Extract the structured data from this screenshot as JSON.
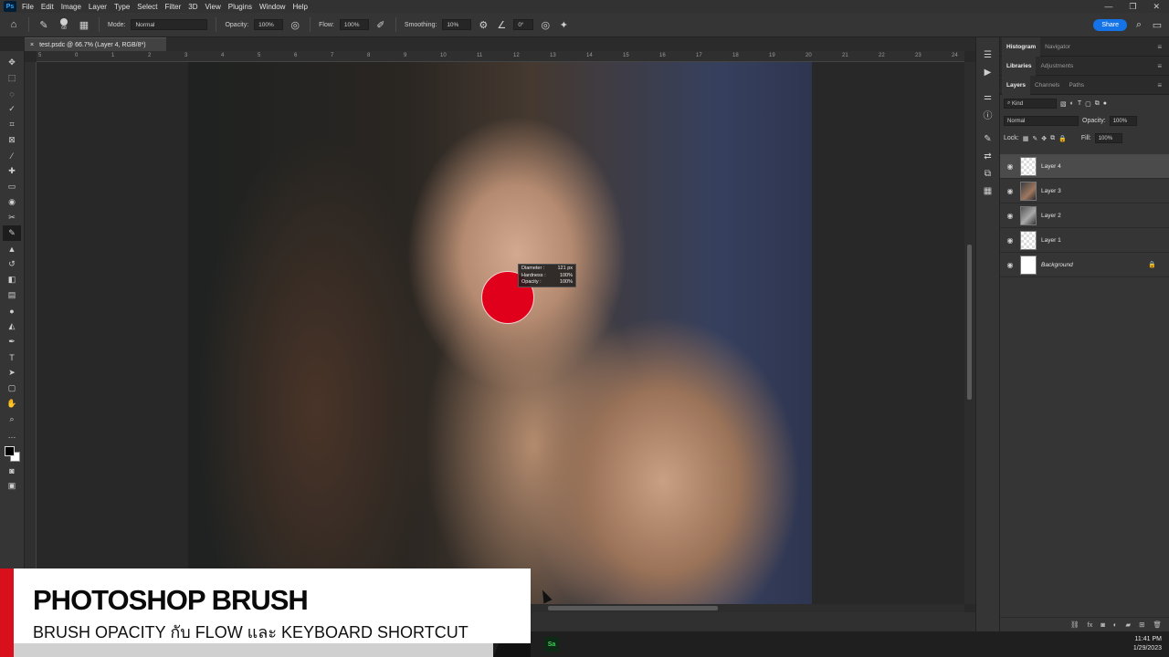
{
  "menubar": {
    "logo": "Ps",
    "items": [
      "File",
      "Edit",
      "Image",
      "Layer",
      "Type",
      "Select",
      "Filter",
      "3D",
      "View",
      "Plugins",
      "Window",
      "Help"
    ],
    "window_controls": [
      "—",
      "❐",
      "✕"
    ]
  },
  "options": {
    "brush_size": "68",
    "mode_label": "Mode:",
    "mode_value": "Normal",
    "opacity_label": "Opacity:",
    "opacity_value": "100%",
    "flow_label": "Flow:",
    "flow_value": "100%",
    "smoothing_label": "Smoothing:",
    "smoothing_value": "10%",
    "angle_value": "0°",
    "share_label": "Share"
  },
  "document": {
    "tab_title": "test.psdc @ 66.7% (Layer 4, RGB/8*)",
    "close": "×"
  },
  "ruler_ticks": [
    "5",
    "0",
    "1",
    "2",
    "3",
    "4",
    "5",
    "6",
    "7",
    "8",
    "9",
    "10",
    "11",
    "12",
    "13",
    "14",
    "15",
    "16",
    "17",
    "18",
    "19",
    "20",
    "21",
    "22",
    "23",
    "24"
  ],
  "brush_tip": {
    "diameter_label": "Diameter :",
    "diameter_value": "121 px",
    "hardness_label": "Hardness :",
    "hardness_value": "100%",
    "opacity_label": "Opacity :",
    "opacity_value": "100%",
    "color": "#e0001b"
  },
  "panels": {
    "group1": [
      "Histogram",
      "Navigator"
    ],
    "group2": [
      "Libraries",
      "Adjustments"
    ],
    "group3": [
      "Layers",
      "Channels",
      "Paths"
    ],
    "kind_label": "Kind",
    "blend_mode": "Normal",
    "opacity_label": "Opacity:",
    "opacity_value": "100%",
    "lock_label": "Lock:",
    "fill_label": "Fill:",
    "fill_value": "100%",
    "layers": [
      {
        "name": "Layer 4",
        "selected": true
      },
      {
        "name": "Layer 3",
        "selected": false
      },
      {
        "name": "Layer 2",
        "selected": false
      },
      {
        "name": "Layer 1",
        "selected": false
      },
      {
        "name": "Background",
        "selected": false,
        "locked": true
      }
    ]
  },
  "taskbar": {
    "app_label": "Sa",
    "time": "11:41 PM",
    "date": "1/29/2023"
  },
  "overlay": {
    "title": "PHOTOSHOP BRUSH",
    "subtitle": "BRUSH OPACITY กับ FLOW และ KEYBOARD SHORTCUT",
    "accent_color": "#d8101c"
  }
}
